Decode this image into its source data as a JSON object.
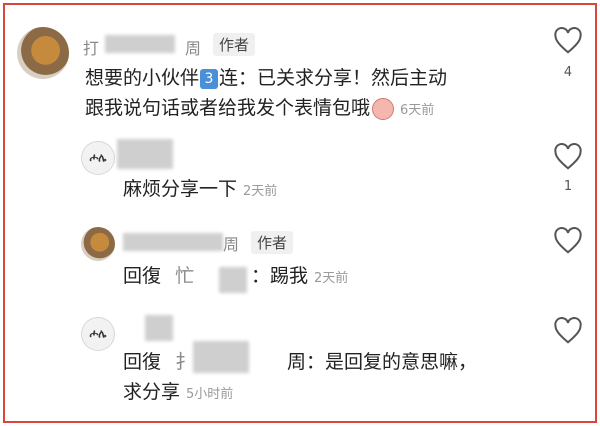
{
  "comments": [
    {
      "author_visible": "打",
      "author_suffix": "周",
      "author_tag": "作者",
      "line1": "想要的小伙伴",
      "num": "3",
      "line1b": "连：已关求分享！然后主动",
      "line2": "跟我说句话或者给我发个表情包哦",
      "time": "6天前",
      "likes": "4"
    },
    {
      "avatar_text": "ሖሌ",
      "body": "麻烦分享一下",
      "time": "2天前",
      "likes": "1"
    },
    {
      "author_suffix": "周",
      "author_tag": "作者",
      "reply_label": "回復",
      "reply_to": "忙",
      "reply_body": "：踢我",
      "time": "2天前"
    },
    {
      "avatar_text": "ሖሌ",
      "reply_label": "回復",
      "reply_to": "扌",
      "reply_suffix": "周：是回复的意思嘛，",
      "line2": "求分享",
      "time": "5小时前"
    }
  ],
  "icons": {
    "like": "heart-outline-icon"
  }
}
